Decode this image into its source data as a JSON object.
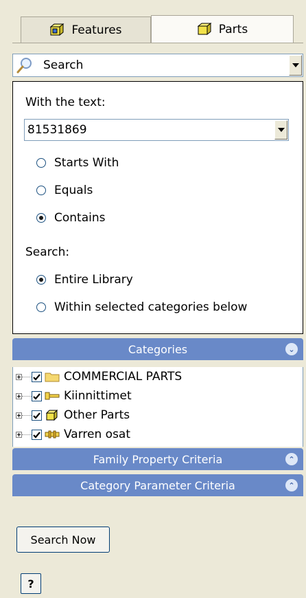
{
  "tabs": [
    {
      "label": "Features",
      "icon": "features-icon",
      "active": false
    },
    {
      "label": "Parts",
      "icon": "parts-icon",
      "active": true
    }
  ],
  "mode_select": {
    "value": "Search",
    "icon": "search-icon"
  },
  "search_panel": {
    "text_label": "With the text:",
    "text_value": "81531869",
    "match_options": [
      {
        "label": "Starts With",
        "selected": false
      },
      {
        "label": "Equals",
        "selected": false
      },
      {
        "label": "Contains",
        "selected": true
      }
    ],
    "scope_label": "Search:",
    "scope_options": [
      {
        "label": "Entire Library",
        "selected": true
      },
      {
        "label": "Within selected categories below",
        "selected": false
      }
    ]
  },
  "categories": {
    "header": "Categories",
    "items": [
      {
        "label": "COMMERCIAL PARTS",
        "checked": true,
        "icon": "folder-icon"
      },
      {
        "label": "Kiinnittimet",
        "checked": true,
        "icon": "fastener-icon"
      },
      {
        "label": "Other Parts",
        "checked": true,
        "icon": "part-icon"
      },
      {
        "label": "Varren osat",
        "checked": true,
        "icon": "shaft-part-icon"
      }
    ]
  },
  "family_property": {
    "header": "Family Property Criteria"
  },
  "category_parameter": {
    "header": "Category Parameter Criteria"
  },
  "actions": {
    "search_now": "Search Now",
    "help": "?"
  },
  "colors": {
    "header_blue": "#6989c8",
    "panel_bg": "#ece9d8"
  }
}
